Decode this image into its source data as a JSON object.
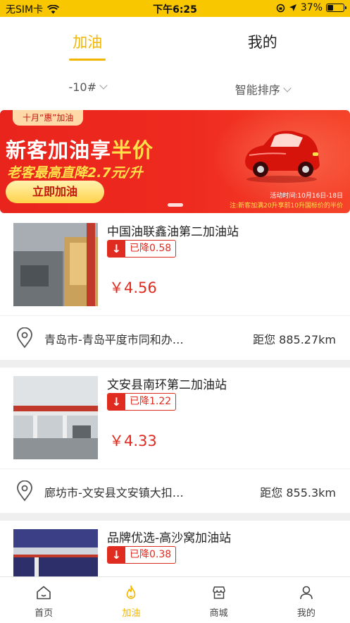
{
  "status_bar": {
    "carrier": "无SIM卡",
    "time": "下午6:25",
    "battery": "37%",
    "battery_level": 0.37
  },
  "top_tabs": [
    {
      "label": "加油",
      "active": true
    },
    {
      "label": "我的",
      "active": false
    }
  ],
  "filters": {
    "fuel_grade": "-10#",
    "sort": "智能排序"
  },
  "banner": {
    "tag": "十月“惠”加油",
    "headline_main": "新客加油享",
    "headline_highlight": "半价",
    "subline": "老客最高直降2.7元/升",
    "cta": "立即加油",
    "period": "活动时间:10月16日-18日",
    "note": "注:新客加满20升享前10升国标价的半价"
  },
  "stations": [
    {
      "name": "中国油联鑫油第二加油站",
      "drop_label": "已降0.58",
      "price": "￥4.56",
      "address": "青岛市-青岛平度市同和办…",
      "distance": "距您 885.27km"
    },
    {
      "name": "文安县南环第二加油站",
      "drop_label": "已降1.22",
      "price": "￥4.33",
      "address": "廊坊市-文安县文安镇大扣…",
      "distance": "距您 855.3km"
    },
    {
      "name": "品牌优选-高沙窝加油站",
      "drop_label": "已降0.38",
      "price": "",
      "address": "",
      "distance": ""
    }
  ],
  "tabbar": [
    {
      "label": "首页",
      "icon": "home-icon",
      "active": false
    },
    {
      "label": "加油",
      "icon": "flame-icon",
      "active": true
    },
    {
      "label": "商城",
      "icon": "store-icon",
      "active": false
    },
    {
      "label": "我的",
      "icon": "person-icon",
      "active": false
    }
  ],
  "colors": {
    "accent": "#f2b500",
    "status_bar": "#f8c700",
    "price_red": "#e02b20"
  }
}
